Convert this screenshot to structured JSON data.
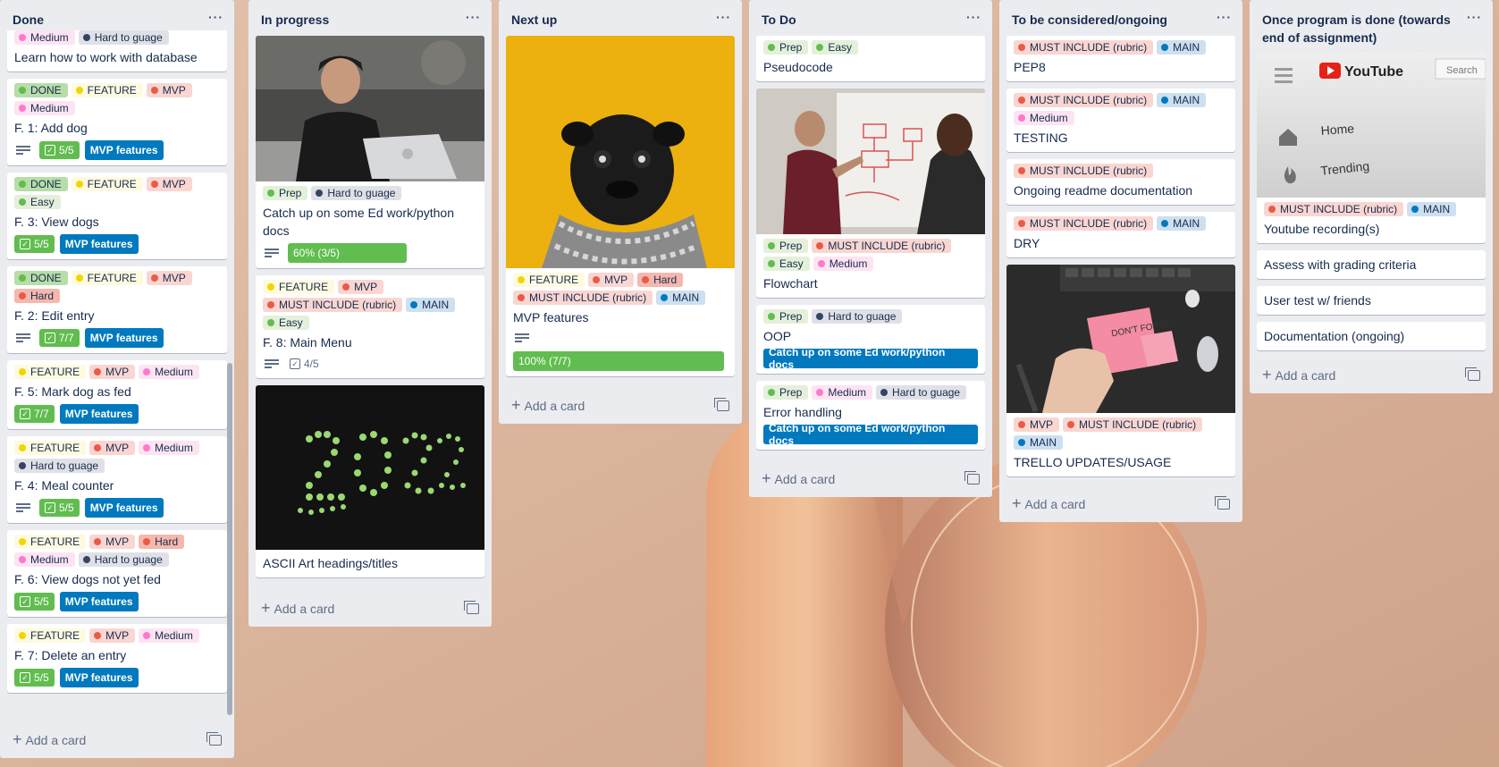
{
  "colors": {
    "label_dot": {
      "green": "#61bd4f",
      "yellow": "#f2d600",
      "orange": "#ff9f1a",
      "red": "#eb5a46",
      "pink": "#ff78cb",
      "blue": "#0079bf",
      "sky": "#00c2e0",
      "black": "#344563"
    },
    "label_bg": {
      "green": "#e4f0d9",
      "yellow": "#fdfae0",
      "red": "#f9d6d1",
      "pink": "#fde4f2",
      "blue": "#cce0f0",
      "sky": "#d9f4fa",
      "black": "#dfe1e6",
      "orange": "#fdecd7"
    }
  },
  "add_card_label": "Add a card",
  "lists": [
    {
      "title": "Done",
      "menu": "···",
      "cards": [
        {
          "labels": [
            {
              "text": "Medium",
              "color": "pink"
            },
            {
              "text": "Hard to guage",
              "color": "black"
            }
          ],
          "title": "Learn how to work with database"
        },
        {
          "labels": [
            {
              "text": "DONE",
              "color": "green",
              "strong": true
            },
            {
              "text": "FEATURE",
              "color": "yellow"
            },
            {
              "text": "MVP",
              "color": "red"
            },
            {
              "text": "Medium",
              "color": "pink"
            }
          ],
          "title": "F. 1: Add dog",
          "desc": true,
          "checklist": "5/5",
          "link": "MVP features"
        },
        {
          "labels": [
            {
              "text": "DONE",
              "color": "green",
              "strong": true
            },
            {
              "text": "FEATURE",
              "color": "yellow"
            },
            {
              "text": "MVP",
              "color": "red"
            },
            {
              "text": "Easy",
              "color": "green"
            }
          ],
          "title": "F. 3: View dogs",
          "checklist": "5/5",
          "link": "MVP features"
        },
        {
          "labels": [
            {
              "text": "DONE",
              "color": "green",
              "strong": true
            },
            {
              "text": "FEATURE",
              "color": "yellow"
            },
            {
              "text": "MVP",
              "color": "red"
            },
            {
              "text": "Hard",
              "color": "red",
              "strong": true
            }
          ],
          "title": "F. 2: Edit entry",
          "desc": true,
          "checklist": "7/7",
          "link": "MVP features"
        },
        {
          "labels": [
            {
              "text": "FEATURE",
              "color": "yellow"
            },
            {
              "text": "MVP",
              "color": "red"
            },
            {
              "text": "Medium",
              "color": "pink"
            }
          ],
          "title": "F. 5: Mark dog as fed",
          "checklist": "7/7",
          "link": "MVP features"
        },
        {
          "labels": [
            {
              "text": "FEATURE",
              "color": "yellow"
            },
            {
              "text": "MVP",
              "color": "red"
            },
            {
              "text": "Medium",
              "color": "pink"
            },
            {
              "text": "Hard to guage",
              "color": "black"
            }
          ],
          "title": "F. 4: Meal counter",
          "desc": true,
          "checklist": "5/5",
          "link": "MVP features"
        },
        {
          "labels": [
            {
              "text": "FEATURE",
              "color": "yellow"
            },
            {
              "text": "MVP",
              "color": "red"
            },
            {
              "text": "Hard",
              "color": "red",
              "strong": true
            },
            {
              "text": "Medium",
              "color": "pink"
            },
            {
              "text": "Hard to guage",
              "color": "black"
            }
          ],
          "title": "F. 6: View dogs not yet fed",
          "checklist": "5/5",
          "link": "MVP features"
        },
        {
          "labels": [
            {
              "text": "FEATURE",
              "color": "yellow"
            },
            {
              "text": "MVP",
              "color": "red"
            },
            {
              "text": "Medium",
              "color": "pink"
            }
          ],
          "title": "F. 7: Delete an entry",
          "checklist": "5/5",
          "link": "MVP features"
        }
      ]
    },
    {
      "title": "In progress",
      "menu": "···",
      "cards": [
        {
          "cover": "laptop-photo",
          "labels": [
            {
              "text": "Prep",
              "color": "green"
            },
            {
              "text": "Hard to guage",
              "color": "black"
            }
          ],
          "title": "Catch up on some Ed work/python docs",
          "desc": true,
          "progress": "60% (3/5)",
          "progress_value": 0.6
        },
        {
          "labels": [
            {
              "text": "FEATURE",
              "color": "yellow"
            },
            {
              "text": "MVP",
              "color": "red"
            },
            {
              "text": "MUST INCLUDE (rubric)",
              "color": "red"
            },
            {
              "text": "MAIN",
              "color": "blue"
            },
            {
              "text": "Easy",
              "color": "green"
            }
          ],
          "title": "F. 8: Main Menu",
          "desc": true,
          "checklist_plain": "4/5"
        },
        {
          "cover": "2022-photo",
          "title": "ASCII Art headings/titles"
        }
      ]
    },
    {
      "title": "Next up",
      "menu": "···",
      "cards": [
        {
          "cover": "pug-photo",
          "labels": [
            {
              "text": "FEATURE",
              "color": "yellow"
            },
            {
              "text": "MVP",
              "color": "red"
            },
            {
              "text": "Hard",
              "color": "red",
              "strong": true
            },
            {
              "text": "MUST INCLUDE (rubric)",
              "color": "red"
            },
            {
              "text": "MAIN",
              "color": "blue"
            }
          ],
          "title": "MVP features",
          "desc": true,
          "progress": "100% (7/7)",
          "progress_value": 1.0
        }
      ]
    },
    {
      "title": "To Do",
      "menu": "···",
      "cards": [
        {
          "labels": [
            {
              "text": "Prep",
              "color": "green"
            },
            {
              "text": "Easy",
              "color": "green"
            }
          ],
          "title": "Pseudocode"
        },
        {
          "cover": "whiteboard-photo",
          "labels": [
            {
              "text": "Prep",
              "color": "green"
            },
            {
              "text": "MUST INCLUDE (rubric)",
              "color": "red"
            },
            {
              "text": "Easy",
              "color": "green"
            },
            {
              "text": "Medium",
              "color": "pink"
            }
          ],
          "title": "Flowchart"
        },
        {
          "labels": [
            {
              "text": "Prep",
              "color": "green"
            },
            {
              "text": "Hard to guage",
              "color": "black"
            }
          ],
          "title": "OOP",
          "link": "Catch up on some Ed work/python docs"
        },
        {
          "labels": [
            {
              "text": "Prep",
              "color": "green"
            },
            {
              "text": "Medium",
              "color": "pink"
            },
            {
              "text": "Hard to guage",
              "color": "black"
            }
          ],
          "title": "Error handling",
          "link": "Catch up on some Ed work/python docs"
        }
      ]
    },
    {
      "title": "To be considered/ongoing",
      "menu": "···",
      "cards": [
        {
          "labels": [
            {
              "text": "MUST INCLUDE (rubric)",
              "color": "red"
            },
            {
              "text": "MAIN",
              "color": "blue"
            }
          ],
          "title": "PEP8"
        },
        {
          "labels": [
            {
              "text": "MUST INCLUDE (rubric)",
              "color": "red"
            },
            {
              "text": "MAIN",
              "color": "blue"
            },
            {
              "text": "Medium",
              "color": "pink"
            }
          ],
          "title": "TESTING"
        },
        {
          "labels": [
            {
              "text": "MUST INCLUDE (rubric)",
              "color": "red"
            }
          ],
          "title": "Ongoing readme documentation"
        },
        {
          "labels": [
            {
              "text": "MUST INCLUDE (rubric)",
              "color": "red"
            },
            {
              "text": "MAIN",
              "color": "blue"
            }
          ],
          "title": "DRY"
        },
        {
          "cover": "dont-forget-photo",
          "cover_text": "DON'T FORGET!",
          "labels": [
            {
              "text": "MVP",
              "color": "red"
            },
            {
              "text": "MUST INCLUDE (rubric)",
              "color": "red"
            },
            {
              "text": "MAIN",
              "color": "blue"
            }
          ],
          "title": "TRELLO UPDATES/USAGE"
        }
      ]
    },
    {
      "title": "Once program is done (towards end of assignment)",
      "menu": "···",
      "cards": [
        {
          "cover": "youtube-screenshot",
          "cover_text": {
            "brand": "YouTube",
            "search": "Search",
            "home": "Home",
            "trending": "Trending"
          },
          "labels": [
            {
              "text": "MUST INCLUDE (rubric)",
              "color": "red"
            },
            {
              "text": "MAIN",
              "color": "blue"
            }
          ],
          "title": "Youtube recording(s)"
        },
        {
          "title": "Assess with grading criteria"
        },
        {
          "title": "User test w/ friends"
        },
        {
          "title": "Documentation (ongoing)"
        }
      ]
    }
  ]
}
